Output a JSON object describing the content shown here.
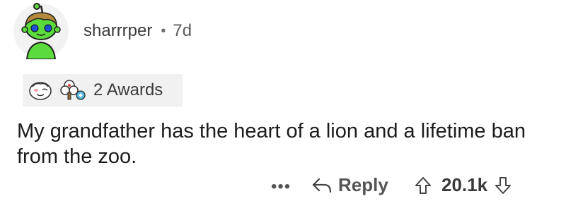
{
  "comment": {
    "author": "sharrrper",
    "separator": "•",
    "age": "7d",
    "awards": {
      "count_label": "2 Awards",
      "icons": [
        "wholesome-seal-icon",
        "award-tree-icon"
      ]
    },
    "text": "My grandfather has the heart of a lion and a lifetime ban from the zoo.",
    "actions": {
      "more_label": "•••",
      "reply_label": "Reply",
      "score": "20.1k"
    }
  },
  "colors": {
    "avatar_green": "#5bdc3c",
    "avatar_bg": "#f2f2f2",
    "awards_bg": "#f1f1f1",
    "text": "#1c1c1c",
    "muted": "#555555"
  }
}
